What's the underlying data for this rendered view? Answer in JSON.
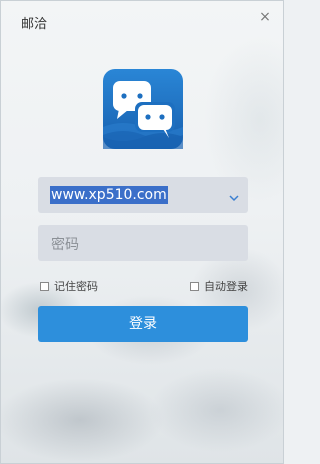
{
  "window": {
    "title": "邮洽",
    "close_glyph": "×"
  },
  "logo": {
    "icon": "chat-bubbles-icon"
  },
  "account": {
    "value": "www.xp510.com",
    "dropdown_icon": "chevron-down-icon"
  },
  "password": {
    "placeholder": "密码"
  },
  "options": {
    "remember_password": "记住密码",
    "auto_login": "自动登录",
    "remember_checked": false,
    "auto_login_checked": false
  },
  "login_button": {
    "label": "登录"
  },
  "colors": {
    "primary": "#2d8fdc",
    "logo_bg": "#1d6fc0",
    "field_bg": "#d9dde4"
  }
}
